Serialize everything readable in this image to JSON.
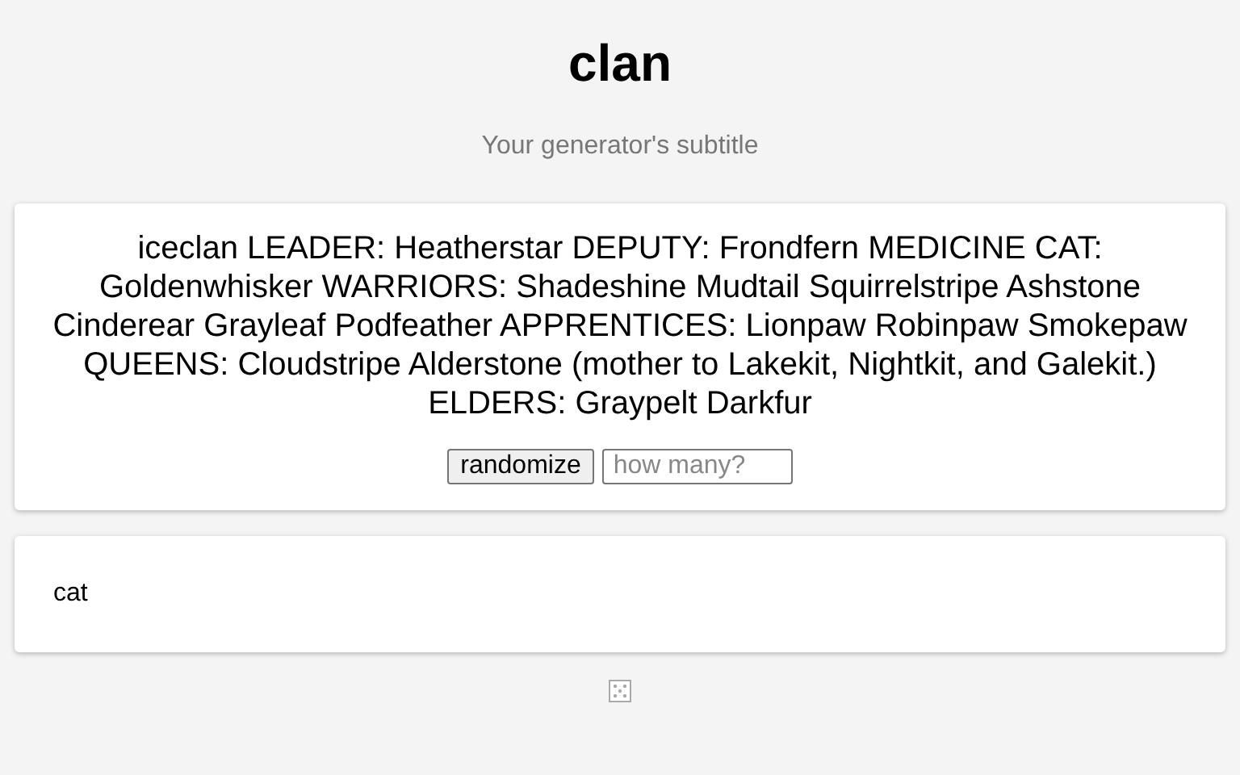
{
  "title": "clan",
  "subtitle": "Your generator's subtitle",
  "output": {
    "text": "iceclan LEADER: Heatherstar DEPUTY: Frondfern MEDICINE CAT: Goldenwhisker WARRIORS: Shadeshine Mudtail Squirrelstripe Ashstone Cinderear Grayleaf Podfeather APPRENTICES: Lionpaw Robinpaw Smokepaw QUEENS: Cloudstripe Alderstone (mother to Lakekit, Nightkit, and Galekit.) ELDERS: Graypelt Darkfur",
    "button": "randomize",
    "count_placeholder": "how many?"
  },
  "second_card": {
    "text": "cat"
  }
}
